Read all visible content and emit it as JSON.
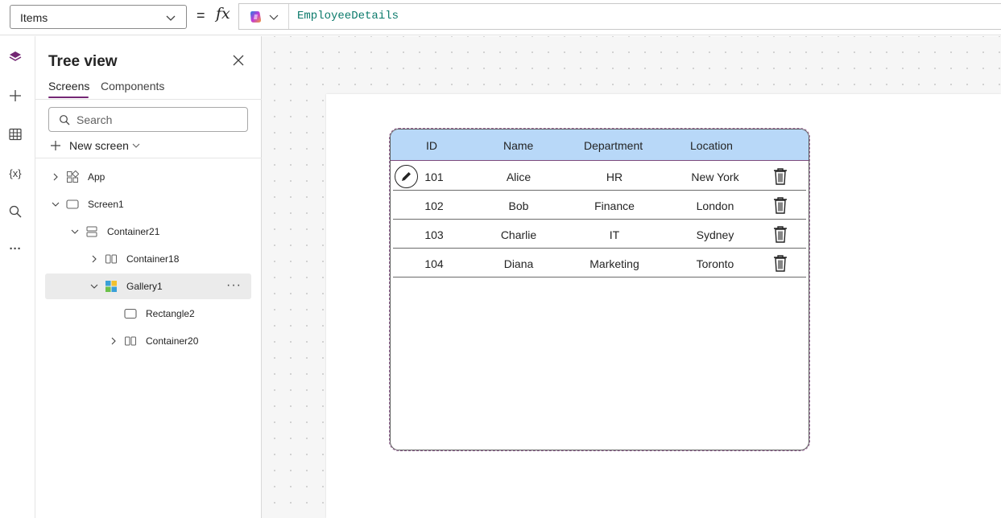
{
  "formula_bar": {
    "property": "Items",
    "equals": "=",
    "fx": "fx",
    "formula": "EmployeeDetails"
  },
  "rail": {
    "items": [
      "layers-icon",
      "plus-icon",
      "table-icon",
      "variables-icon",
      "search-icon",
      "more-icon"
    ],
    "variables_text": "{x}",
    "more_text": "···"
  },
  "tree_view": {
    "title": "Tree view",
    "tabs": [
      {
        "label": "Screens",
        "active": true
      },
      {
        "label": "Components",
        "active": false
      }
    ],
    "search_placeholder": "Search",
    "new_screen_label": "New screen",
    "nodes": [
      {
        "label": "App",
        "icon": "app-icon",
        "expander": "collapsed"
      },
      {
        "label": "Screen1",
        "icon": "screen-icon",
        "expander": "expanded"
      },
      {
        "label": "Container21",
        "icon": "vertical-container-icon",
        "expander": "expanded"
      },
      {
        "label": "Container18",
        "icon": "horizontal-container-icon",
        "expander": "collapsed"
      },
      {
        "label": "Gallery1",
        "icon": "gallery-icon",
        "expander": "expanded",
        "selected": true
      },
      {
        "label": "Rectangle2",
        "icon": "rectangle-icon",
        "expander": "none"
      },
      {
        "label": "Container20",
        "icon": "horizontal-container-icon",
        "expander": "collapsed"
      }
    ],
    "more_text": "···"
  },
  "gallery": {
    "headers": [
      "ID",
      "Name",
      "Department",
      "Location"
    ],
    "rows": [
      {
        "id": "101",
        "name": "Alice",
        "department": "HR",
        "location": "New York"
      },
      {
        "id": "102",
        "name": "Bob",
        "department": "Finance",
        "location": "London"
      },
      {
        "id": "103",
        "name": "Charlie",
        "department": "IT",
        "location": "Sydney"
      },
      {
        "id": "104",
        "name": "Diana",
        "department": "Marketing",
        "location": "Toronto"
      }
    ],
    "header_color": "#b8d8f8"
  },
  "colors": {
    "accent": "#742774",
    "formula_text": "#0b7a6b"
  }
}
